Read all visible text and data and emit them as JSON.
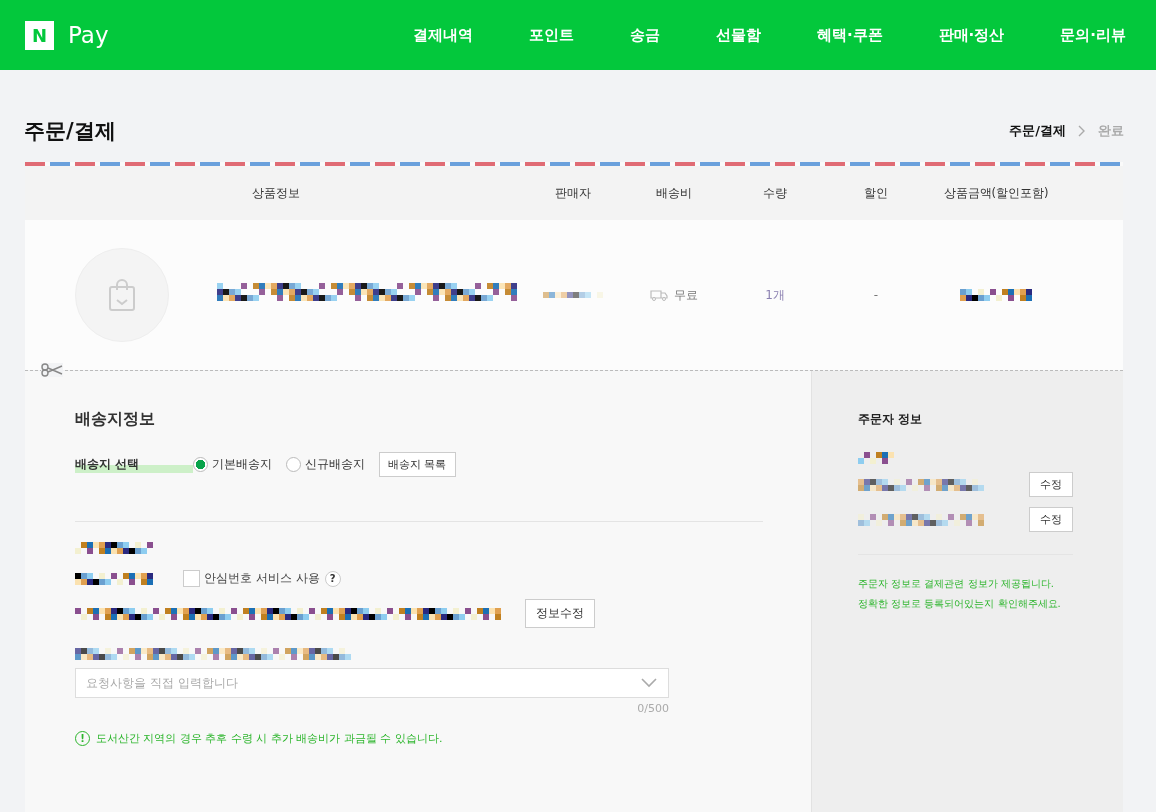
{
  "header": {
    "logo_mark": "N",
    "logo_text": "Pay",
    "nav": [
      {
        "label": "결제내역"
      },
      {
        "label": "포인트"
      },
      {
        "label": "송금"
      },
      {
        "label": "선물함"
      },
      {
        "label": "혜택·쿠폰"
      },
      {
        "label": "판매·정산"
      },
      {
        "label": "문의·리뷰"
      }
    ]
  },
  "page_title": "주문/결제",
  "steps": [
    {
      "label": "주문/결제",
      "selected": true
    },
    {
      "label": "완료",
      "selected": false
    }
  ],
  "table": {
    "columns": [
      "상품정보",
      "판매자",
      "배송비",
      "수량",
      "할인",
      "상품금액(할인포함)"
    ],
    "rows": [
      {
        "shipping": "무료",
        "quantity": "1개",
        "discount": "-"
      }
    ]
  },
  "shipping": {
    "title": "배송지정보",
    "select_label": "배송지 선택",
    "options": [
      {
        "label": "기본배송지",
        "selected": true
      },
      {
        "label": "신규배송지",
        "selected": false
      }
    ],
    "list_button": "배송지 목록",
    "safe_number": {
      "label": "안심번호 서비스 사용",
      "checked": false,
      "help": "?"
    },
    "edit_button": "정보수정",
    "request": {
      "placeholder": "요청사항을 직접 입력합니다",
      "counter": "0/500"
    },
    "notice": "도서산간 지역의 경우 추후 수령 시 추가 배송비가 과금될 수 있습니다.",
    "notice_icon": "!"
  },
  "orderer": {
    "title": "주문자 정보",
    "edit_buttons": [
      "수정",
      "수정"
    ],
    "notice_lines": [
      "주문자 정보로 결제관련 정보가 제공됩니다.",
      "정확한 정보로 등록되어있는지 확인해주세요."
    ]
  }
}
